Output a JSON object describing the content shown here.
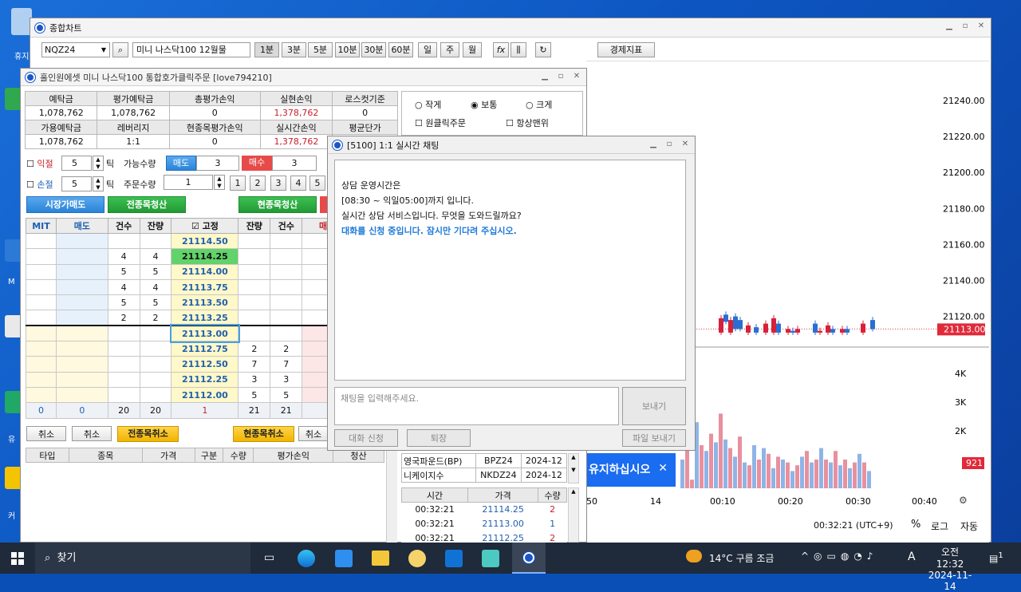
{
  "main": {
    "title": "종합차트",
    "symbol": "NQZ24",
    "symbol_name": "미니 나스닥100 12월물",
    "timeframes": [
      "1분",
      "3분",
      "5분",
      "10분",
      "30분",
      "60분",
      "일",
      "주",
      "월"
    ],
    "fx_label": "fx",
    "indicator_btn": "경제지표"
  },
  "chart": {
    "price_ticks": [
      "21240.00",
      "21220.00",
      "21200.00",
      "21180.00",
      "21160.00",
      "21140.00",
      "21120.00"
    ],
    "current_price": "21113.00",
    "vol_ticks": [
      "4K",
      "3K",
      "2K"
    ],
    "vol_current": "921",
    "time_ticks": [
      "50",
      "14",
      "00:10",
      "00:20",
      "00:30",
      "00:40"
    ],
    "status_time": "00:32:21 (UTC+9)",
    "pct": "%",
    "log": "로그",
    "auto": "자동"
  },
  "order": {
    "title": "홀인원에셋 미니 나스닥100 통합호가클릭주문 [love794210]",
    "acct_h1": [
      "예탁금",
      "평가예탁금",
      "총평가손익",
      "실현손익",
      "로스컷기준"
    ],
    "acct_v1": [
      "1,078,762",
      "1,078,762",
      "0",
      "1,378,762",
      "0"
    ],
    "acct_h2": [
      "가용예탁금",
      "레버리지",
      "현종목평가손익",
      "실시간손익",
      "평균단가"
    ],
    "acct_v2": [
      "1,078,762",
      "1:1",
      "0",
      "1,378,762",
      ""
    ],
    "size_opts": [
      "작게",
      "보통",
      "크게"
    ],
    "one_click": "원클릭주문",
    "always_top": "항상맨위",
    "take_profit": "익절",
    "tp_val": "5",
    "stop_loss": "손절",
    "sl_val": "5",
    "tick": "틱",
    "avail_qty": "가능수량",
    "sell_label": "매도",
    "sell_qty": "3",
    "buy_label": "매수",
    "buy_qty": "3",
    "order_qty": "주문수량",
    "order_qty_val": "1",
    "qty_btns": [
      "1",
      "2",
      "3",
      "4",
      "5"
    ],
    "market_sell": "시장가매도",
    "all_close": "전종목청산",
    "cur_close": "현종목청산",
    "ob_headers": [
      "MIT",
      "매도",
      "건수",
      "잔량",
      "고정",
      "잔량",
      "건수",
      "매"
    ],
    "ob_rows": [
      {
        "p": "21114.50",
        "sc": "",
        "sq": "",
        "bq": "",
        "bc": ""
      },
      {
        "p": "21114.25",
        "sc": "4",
        "sq": "4",
        "bq": "",
        "bc": ""
      },
      {
        "p": "21114.00",
        "sc": "5",
        "sq": "5",
        "bq": "",
        "bc": ""
      },
      {
        "p": "21113.75",
        "sc": "4",
        "sq": "4",
        "bq": "",
        "bc": ""
      },
      {
        "p": "21113.50",
        "sc": "5",
        "sq": "5",
        "bq": "",
        "bc": ""
      },
      {
        "p": "21113.25",
        "sc": "2",
        "sq": "2",
        "bq": "",
        "bc": ""
      },
      {
        "p": "21113.00",
        "sc": "",
        "sq": "",
        "bq": "",
        "bc": ""
      },
      {
        "p": "21112.75",
        "sc": "",
        "sq": "",
        "bq": "2",
        "bc": "2"
      },
      {
        "p": "21112.50",
        "sc": "",
        "sq": "",
        "bq": "7",
        "bc": "7"
      },
      {
        "p": "21112.25",
        "sc": "",
        "sq": "",
        "bq": "3",
        "bc": "3"
      },
      {
        "p": "21112.00",
        "sc": "",
        "sq": "",
        "bq": "5",
        "bc": "5"
      }
    ],
    "ob_totals": [
      "0",
      "0",
      "20",
      "20",
      "1",
      "21",
      "21"
    ],
    "cancel": "취소",
    "all_cancel": "전종목취소",
    "cur_cancel": "현종목취소",
    "pos_headers": [
      "타입",
      "종목",
      "가격",
      "구분",
      "수량",
      "평가손익",
      "청산"
    ]
  },
  "chat": {
    "title": "[5100] 1:1 실시간 채팅",
    "lines": [
      "상담 운영시간은",
      "[08:30 ~ 익일05:00]까지 입니다.",
      "실시간 상담 서비스입니다. 무엇을 도와드릴까요?"
    ],
    "notice": "대화를 신청 중입니다. 잠시만 기다려 주십시오.",
    "placeholder": "채팅을 입력해주세요.",
    "send": "보내기",
    "request": "대화 신청",
    "leave": "퇴장",
    "send_file": "파일 보내기"
  },
  "markets": [
    {
      "name": "영국파운드(BP)",
      "code": "BPZ24",
      "exp": "2024-12"
    },
    {
      "name": "니케이지수",
      "code": "NKDZ24",
      "exp": "2024-12"
    }
  ],
  "ticks": {
    "headers": [
      "시간",
      "가격",
      "수량"
    ],
    "rows": [
      {
        "t": "00:32:21",
        "p": "21114.25",
        "q": "2"
      },
      {
        "t": "00:32:21",
        "p": "21113.00",
        "q": "1"
      },
      {
        "t": "00:32:21",
        "p": "21112.25",
        "q": "2"
      }
    ]
  },
  "banner": "유지하십시오",
  "taskbar": {
    "search": "찾기",
    "weather": "14°C 구름 조금",
    "time": "오전 12:32",
    "date": "2024-11-14",
    "lang": "A",
    "notif": "1"
  },
  "desktop": [
    "휴지",
    "M",
    "유",
    "커"
  ]
}
